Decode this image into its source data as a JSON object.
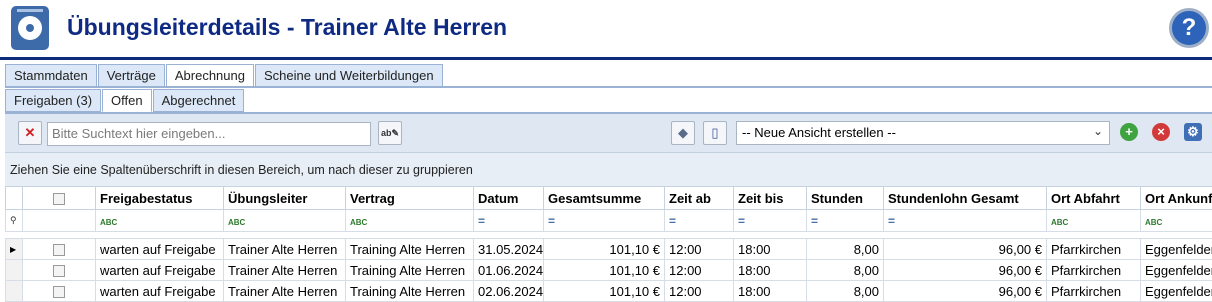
{
  "header": {
    "title": "Übungsleiterdetails - Trainer Alte Herren",
    "help_glyph": "?"
  },
  "tabs_main": [
    "Stammdaten",
    "Verträge",
    "Abrechnung",
    "Scheine und Weiterbildungen"
  ],
  "tabs_main_active": "Abrechnung",
  "tabs_sub": [
    "Freigaben (3)",
    "Offen",
    "Abgerechnet"
  ],
  "tabs_sub_active": "Offen",
  "toolbar": {
    "search_placeholder": "Bitte Suchtext hier eingeben...",
    "view_selected": "-- Neue Ansicht erstellen --",
    "icons": [
      "clear-icon",
      "spellcheck-icon",
      "layers-icon",
      "book-icon",
      "add-icon",
      "delete-icon",
      "settings-icon"
    ]
  },
  "group_hint": "Ziehen Sie eine Spaltenüberschrift in diesen Bereich, um nach dieser zu gruppieren",
  "columns": [
    "Freigabestatus",
    "Übungsleiter",
    "Vertrag",
    "Datum",
    "Gesamtsumme",
    "Zeit ab",
    "Zeit bis",
    "Stunden",
    "Stundenlohn Gesamt",
    "Ort Abfahrt",
    "Ort Ankunft"
  ],
  "filter_types": [
    "abc",
    "abc",
    "abc",
    "=",
    "=",
    "=",
    "=",
    "=",
    "=",
    "abc",
    "abc"
  ],
  "rows": [
    {
      "status": "warten auf Freigabe",
      "leiter": "Trainer Alte Herren",
      "vertrag": "Training Alte Herren",
      "datum": "31.05.2024",
      "summe": "101,10 €",
      "ab": "12:00",
      "bis": "18:00",
      "stunden": "8,00",
      "lohn": "96,00 €",
      "abfahrt": "Pfarrkirchen",
      "ankunft": "Eggenfelden"
    },
    {
      "status": "warten auf Freigabe",
      "leiter": "Trainer Alte Herren",
      "vertrag": "Training Alte Herren",
      "datum": "01.06.2024",
      "summe": "101,10 €",
      "ab": "12:00",
      "bis": "18:00",
      "stunden": "8,00",
      "lohn": "96,00 €",
      "abfahrt": "Pfarrkirchen",
      "ankunft": "Eggenfelden"
    },
    {
      "status": "warten auf Freigabe",
      "leiter": "Trainer Alte Herren",
      "vertrag": "Training Alte Herren",
      "datum": "02.06.2024",
      "summe": "101,10 €",
      "ab": "12:00",
      "bis": "18:00",
      "stunden": "8,00",
      "lohn": "96,00 €",
      "abfahrt": "Pfarrkirchen",
      "ankunft": "Eggenfelden"
    }
  ],
  "colors": {
    "title": "#0f2a82",
    "rule": "#0e2a7a",
    "tab_bg": "#dce8f7",
    "toolbar_bg": "#dfe7f2"
  }
}
